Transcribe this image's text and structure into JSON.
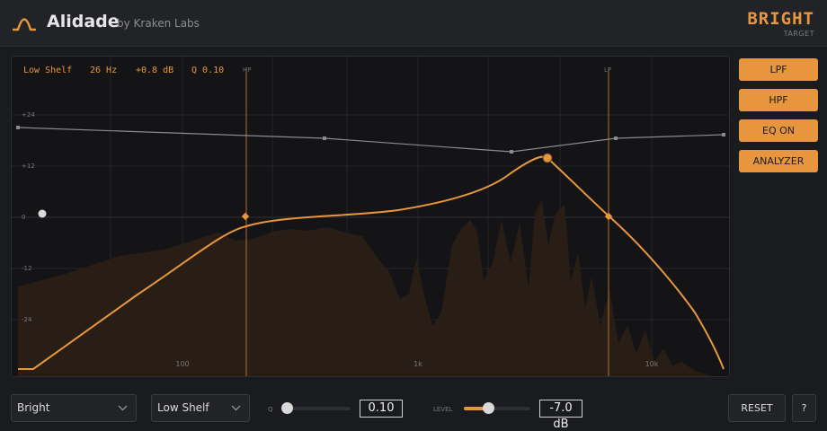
{
  "header": {
    "title": "Alidade",
    "by": "by Kraken Labs",
    "preset_name": "BRIGHT",
    "preset_sub": "TARGET",
    "colors": {
      "accent": "#e8963e",
      "background": "#1a1b1e",
      "panel": "#222326"
    }
  },
  "readout": {
    "band_type": "Low Shelf",
    "freq": "26 Hz",
    "gain": "+0.8 dB",
    "q": "Q 0.10"
  },
  "graph": {
    "y_ticks": [
      "+24",
      "+12",
      "0",
      "-12",
      "-24"
    ],
    "x_ticks": [
      "100",
      "1k",
      "10k"
    ],
    "hp_label": "HP",
    "lp_label": "LP"
  },
  "side_buttons": [
    {
      "label": "LPF"
    },
    {
      "label": "HPF"
    },
    {
      "label": "EQ ON"
    },
    {
      "label": "ANALYZER"
    }
  ],
  "bottom": {
    "preset_select": "Bright",
    "band_select": "Low Shelf",
    "q_label": "Q",
    "q_value": "0.10",
    "q_fraction": 0.0,
    "level_label": "LEVEL",
    "level_value": "-7.0 dB",
    "level_fraction": 0.36,
    "reset_label": "RESET",
    "help_label": "?"
  }
}
